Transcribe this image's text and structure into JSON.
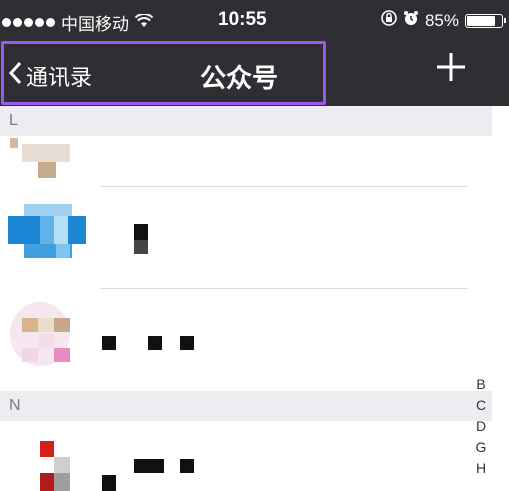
{
  "status_bar": {
    "carrier": "中国移动",
    "time": "10:55",
    "battery": "85%",
    "battery_level": 0.85
  },
  "navbar": {
    "back_label": "通讯录",
    "title": "公众号",
    "add_symbol": "+"
  },
  "sections": [
    {
      "letter": "L"
    },
    {
      "letter": "N"
    }
  ],
  "index_letters": [
    "B",
    "C",
    "D",
    "G",
    "H"
  ]
}
